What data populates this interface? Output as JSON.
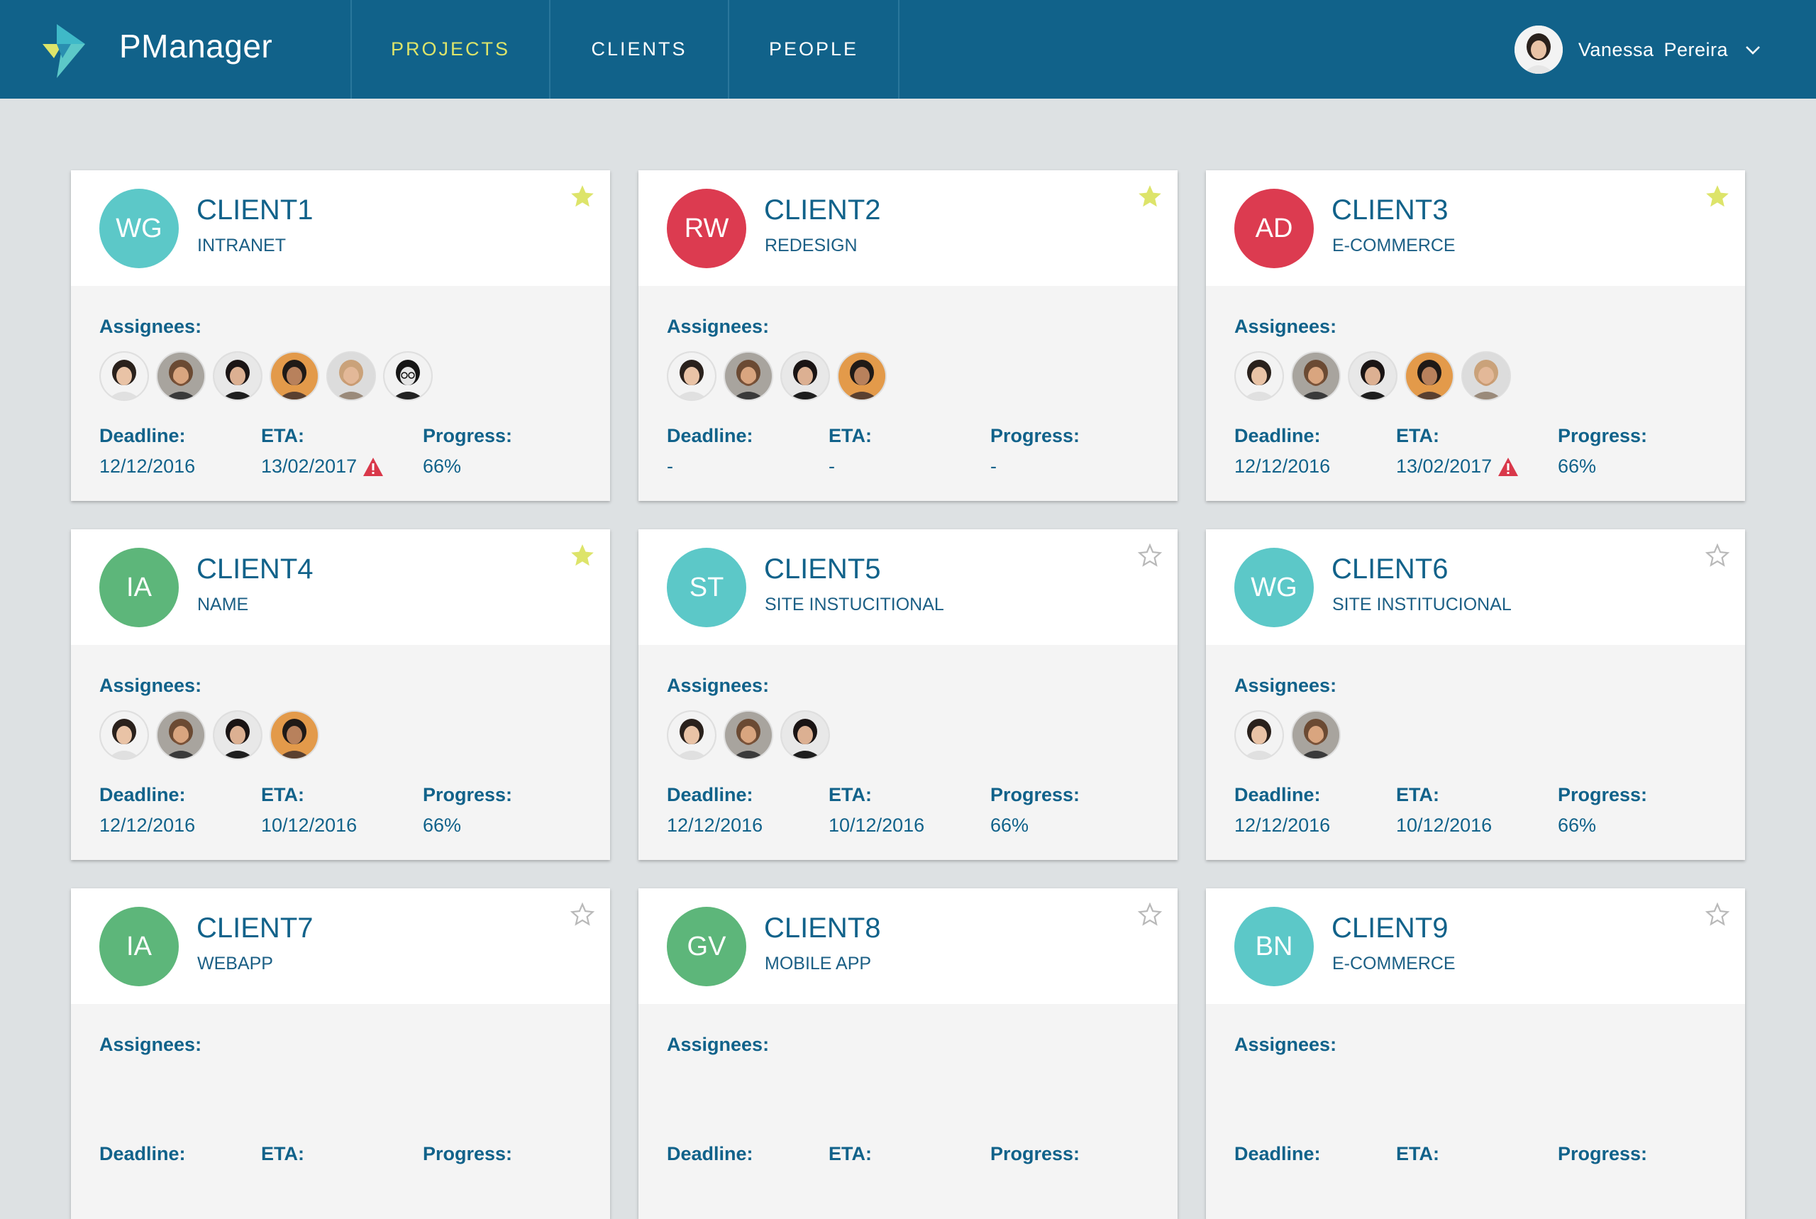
{
  "app": {
    "brand": "PManager",
    "nav": [
      {
        "label": "PROJECTS",
        "active": true
      },
      {
        "label": "CLIENTS",
        "active": false
      },
      {
        "label": "PEOPLE",
        "active": false
      }
    ],
    "user": {
      "name": "Vanessa Pereira"
    }
  },
  "labels": {
    "assignees": "Assignees:",
    "deadline": "Deadline:",
    "eta": "ETA:",
    "progress": "Progress:"
  },
  "colors": {
    "topbar": "#11628a",
    "nav_active": "#dde46a",
    "star_filled": "#dde46a",
    "warning": "#d9384a"
  },
  "cards": [
    {
      "initials": "WG",
      "avatar_color": "#5cc8c8",
      "client": "CLIENT1",
      "project": "INTRANET",
      "starred": true,
      "assignees": [
        "woman-1",
        "man-beard",
        "woman-2",
        "man-orange",
        "man-blond",
        "woman-glasses"
      ],
      "deadline": "12/12/2016",
      "eta": "13/02/2017",
      "eta_warning": true,
      "progress": "66%"
    },
    {
      "initials": "RW",
      "avatar_color": "#dc3b50",
      "client": "CLIENT2",
      "project": "REDESIGN",
      "starred": true,
      "assignees": [
        "woman-1",
        "man-beard",
        "woman-2",
        "man-orange"
      ],
      "deadline": "-",
      "eta": "-",
      "eta_warning": false,
      "progress": "-"
    },
    {
      "initials": "AD",
      "avatar_color": "#dc3b50",
      "client": "CLIENT3",
      "project": "E-COMMERCE",
      "starred": true,
      "assignees": [
        "woman-1",
        "man-beard",
        "woman-2",
        "man-orange",
        "man-blond"
      ],
      "deadline": "12/12/2016",
      "eta": "13/02/2017",
      "eta_warning": true,
      "progress": "66%"
    },
    {
      "initials": "IA",
      "avatar_color": "#5db67a",
      "client": "CLIENT4",
      "project": "NAME",
      "starred": true,
      "assignees": [
        "woman-1",
        "man-beard",
        "woman-2",
        "man-orange"
      ],
      "deadline": "12/12/2016",
      "eta": "10/12/2016",
      "eta_warning": false,
      "progress": "66%"
    },
    {
      "initials": "ST",
      "avatar_color": "#5cc8c8",
      "client": "CLIENT5",
      "project": "SITE INSTUCITIONAL",
      "starred": false,
      "assignees": [
        "woman-1",
        "man-beard",
        "woman-2"
      ],
      "deadline": "12/12/2016",
      "eta": "10/12/2016",
      "eta_warning": false,
      "progress": "66%"
    },
    {
      "initials": "WG",
      "avatar_color": "#5cc8c8",
      "client": "CLIENT6",
      "project": "SITE INSTITUCIONAL",
      "starred": false,
      "assignees": [
        "woman-1",
        "man-beard"
      ],
      "deadline": "12/12/2016",
      "eta": "10/12/2016",
      "eta_warning": false,
      "progress": "66%"
    },
    {
      "initials": "IA",
      "avatar_color": "#5db67a",
      "client": "CLIENT7",
      "project": "WEBAPP",
      "starred": false,
      "assignees": [],
      "deadline": "",
      "eta": "",
      "eta_warning": false,
      "progress": ""
    },
    {
      "initials": "GV",
      "avatar_color": "#5db67a",
      "client": "CLIENT8",
      "project": "MOBILE APP",
      "starred": false,
      "assignees": [],
      "deadline": "",
      "eta": "",
      "eta_warning": false,
      "progress": ""
    },
    {
      "initials": "BN",
      "avatar_color": "#5cc8c8",
      "client": "CLIENT9",
      "project": "E-COMMERCE",
      "starred": false,
      "assignees": [],
      "deadline": "",
      "eta": "",
      "eta_warning": false,
      "progress": ""
    }
  ]
}
